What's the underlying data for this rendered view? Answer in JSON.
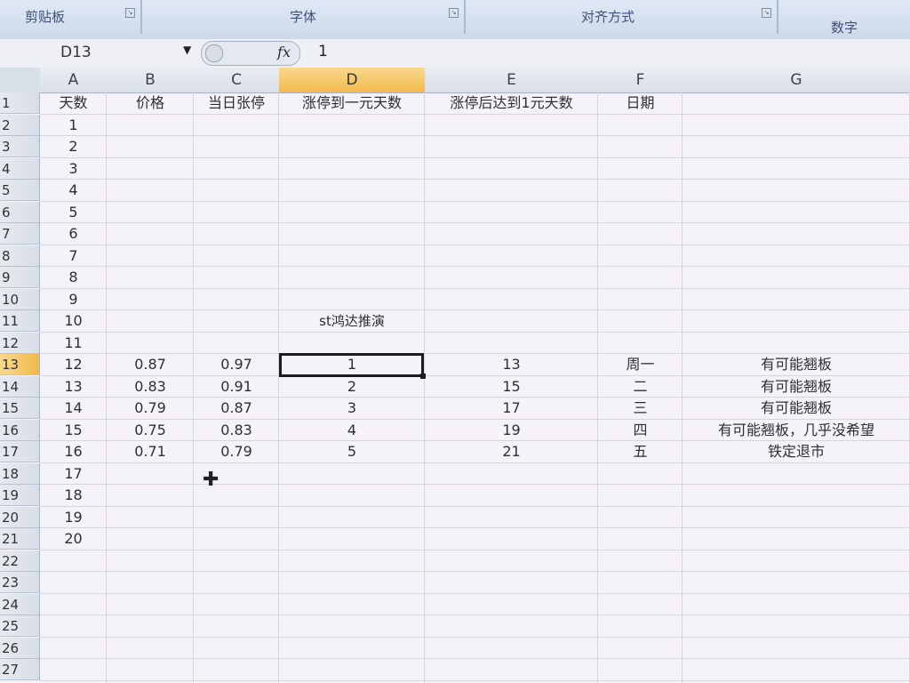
{
  "ribbon": {
    "groups": [
      {
        "label": "剪贴板"
      },
      {
        "label": "字体"
      },
      {
        "label": "对齐方式"
      },
      {
        "label": "数字"
      }
    ]
  },
  "formula_bar": {
    "name_box": "D13",
    "fx_label": "fx",
    "value": "1"
  },
  "columns": [
    "A",
    "B",
    "C",
    "D",
    "E",
    "F",
    "G"
  ],
  "selected_column": "D",
  "selected_row": "13",
  "row_numbers": [
    "1",
    "2",
    "3",
    "4",
    "5",
    "6",
    "7",
    "8",
    "9",
    "10",
    "11",
    "12",
    "13",
    "14",
    "15",
    "16",
    "17",
    "18",
    "19",
    "20",
    "21",
    "22",
    "23",
    "24",
    "25",
    "26",
    "27"
  ],
  "headers": {
    "A": "天数",
    "B": "价格",
    "C": "当日张停",
    "D": "涨停到一元天数",
    "E": "涨停后达到1元天数",
    "F": "日期"
  },
  "col_a_values": [
    "1",
    "2",
    "3",
    "4",
    "5",
    "6",
    "7",
    "8",
    "9",
    "10",
    "11",
    "12",
    "13",
    "14",
    "15",
    "16",
    "17",
    "18",
    "19",
    "20"
  ],
  "note_d11": "st鸿达推演",
  "data_rows": [
    {
      "B": "0.87",
      "C": "0.97",
      "D": "1",
      "E": "13",
      "F": "周一",
      "G": "有可能翘板"
    },
    {
      "B": "0.83",
      "C": "0.91",
      "D": "2",
      "E": "15",
      "F": "二",
      "G": "有可能翘板"
    },
    {
      "B": "0.79",
      "C": "0.87",
      "D": "3",
      "E": "17",
      "F": "三",
      "G": "有可能翘板"
    },
    {
      "B": "0.75",
      "C": "0.83",
      "D": "4",
      "E": "19",
      "F": "四",
      "G": "有可能翘板，几乎没希望"
    },
    {
      "B": "0.71",
      "C": "0.79",
      "D": "5",
      "E": "21",
      "F": "五",
      "G": "铁定退市"
    }
  ]
}
